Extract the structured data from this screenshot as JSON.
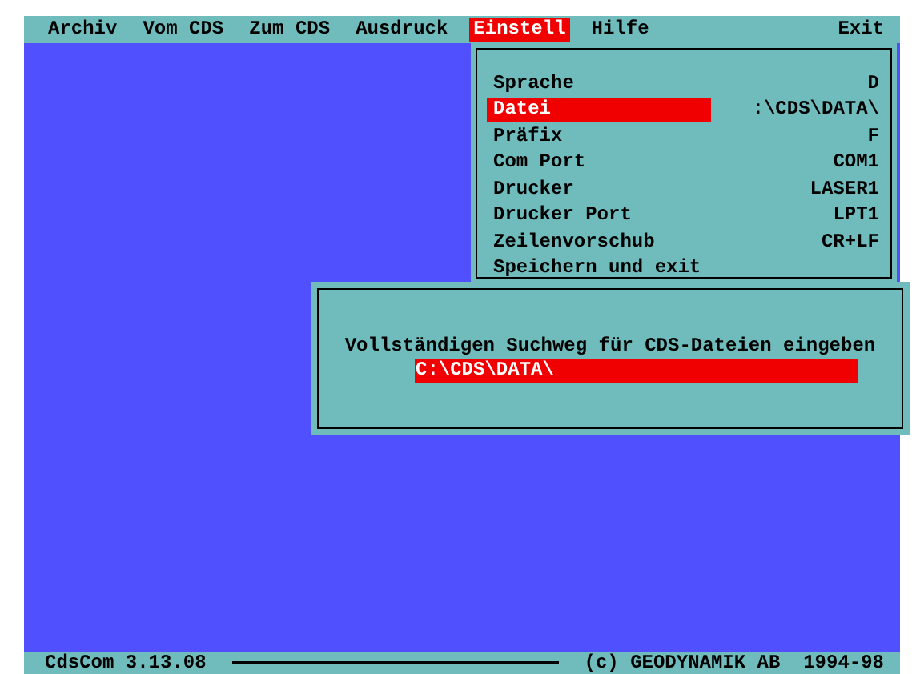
{
  "menu_bar": {
    "items": [
      {
        "label": "Archiv",
        "selected": false
      },
      {
        "label": "Vom CDS",
        "selected": false
      },
      {
        "label": "Zum CDS",
        "selected": false
      },
      {
        "label": "Ausdruck",
        "selected": false
      },
      {
        "label": "Einstell",
        "selected": true
      },
      {
        "label": "Hilfe",
        "selected": false
      }
    ],
    "exit": "Exit"
  },
  "dropdown": {
    "items": [
      {
        "label": "Sprache",
        "value": "D",
        "selected": false
      },
      {
        "label": "Datei",
        "value": ":\\CDS\\DATA\\",
        "selected": true
      },
      {
        "label": "Präfix",
        "value": "F",
        "selected": false
      },
      {
        "label": "Com Port",
        "value": "COM1",
        "selected": false
      },
      {
        "label": "Drucker",
        "value": "LASER1",
        "selected": false
      },
      {
        "label": "Drucker Port",
        "value": "LPT1",
        "selected": false
      },
      {
        "label": "Zeilenvorschub",
        "value": "CR+LF",
        "selected": false
      },
      {
        "label": "Speichern und exit",
        "selected": false
      }
    ]
  },
  "dialog": {
    "prompt": "Vollständigen Suchweg für CDS-Dateien eingeben",
    "value": "C:\\CDS\\DATA\\"
  },
  "status_bar": {
    "app": "CdsCom 3.13.08",
    "copyright": "(c) GEODYNAMIK AB  1994-98"
  }
}
